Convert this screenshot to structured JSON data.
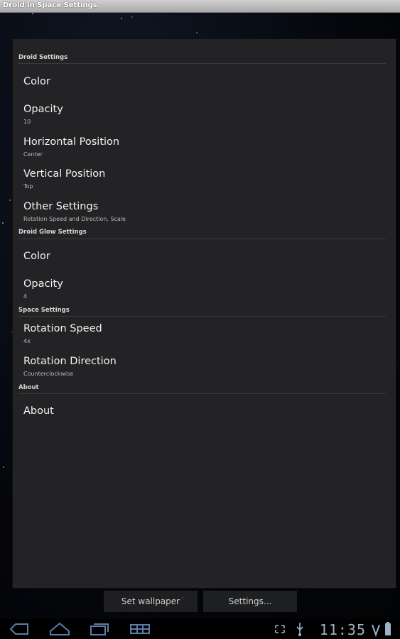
{
  "window_title": "Droid in Space Settings",
  "categories": [
    {
      "title": "Droid Settings",
      "items": [
        {
          "title": "Color",
          "summary": ""
        },
        {
          "title": "Opacity",
          "summary": "10"
        },
        {
          "title": "Horizontal Position",
          "summary": "Center"
        },
        {
          "title": "Vertical Position",
          "summary": "Top"
        },
        {
          "title": "Other Settings",
          "summary": "Rotation Speed and Direction, Scale"
        }
      ]
    },
    {
      "title": "Droid Glow Settings",
      "items": [
        {
          "title": "Color",
          "summary": ""
        },
        {
          "title": "Opacity",
          "summary": "4"
        }
      ]
    },
    {
      "title": "Space Settings",
      "items": [
        {
          "title": "Rotation Speed",
          "summary": "4x"
        },
        {
          "title": "Rotation Direction",
          "summary": "Counterclockwise"
        }
      ]
    },
    {
      "title": "About",
      "items": [
        {
          "title": "About",
          "summary": ""
        }
      ]
    }
  ],
  "bottom_buttons": {
    "set_wallpaper": "Set wallpaper",
    "settings": "Settings..."
  },
  "status": {
    "time": "11:35"
  },
  "icons": {
    "back": "back-icon",
    "home": "home-icon",
    "recent": "recent-apps-icon",
    "menu": "menu-grid-icon",
    "screen": "screen-compat-icon",
    "usb": "usb-icon",
    "battery": "battery-icon",
    "signal": "signal-icon"
  },
  "colors": {
    "panel_bg": "#232325",
    "clock": "#9fb2c6",
    "accent_blue": "#5b7da8"
  }
}
